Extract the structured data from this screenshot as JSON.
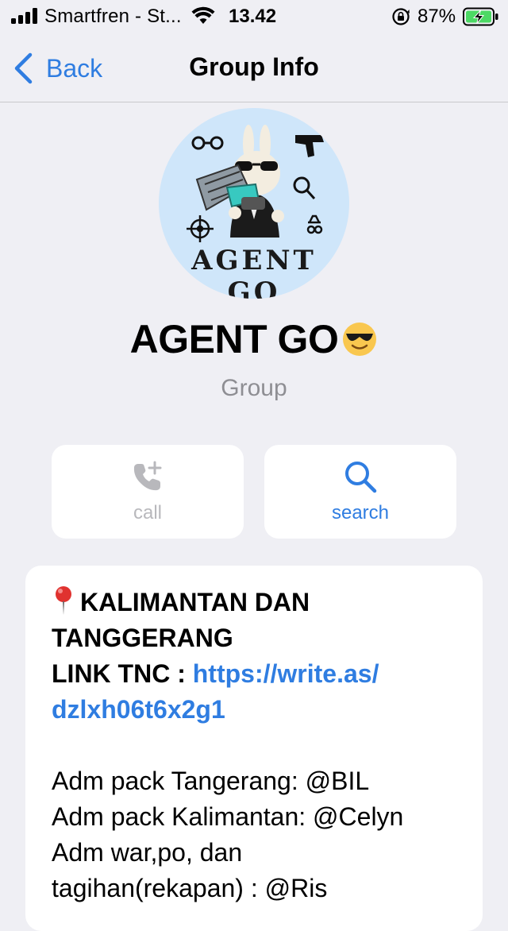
{
  "status_bar": {
    "carrier": "Smartfren - St...",
    "time": "13.42",
    "battery_percent": "87%"
  },
  "nav": {
    "back_label": "Back",
    "title": "Group Info"
  },
  "profile": {
    "avatar_text": "AGENT GO",
    "name": "AGENT GO",
    "name_emoji": "smiling-face-with-sunglasses",
    "subtitle": "Group"
  },
  "actions": {
    "call_label": "call",
    "search_label": "search",
    "call_enabled": false
  },
  "description": {
    "line1": "KALIMANTAN DAN",
    "line2": "TANGGERANG",
    "link_prefix": "LINK TNC : ",
    "link_part1": "https://write.as/",
    "link_part2": "dzlxh06t6x2g1",
    "line_admin1": "Adm pack Tangerang: @BIL",
    "line_admin2": "Adm pack Kalimantan: @Celyn",
    "line_admin3": "Adm war,po, dan",
    "line_admin4": "tagihan(rekapan) : @Ris"
  },
  "colors": {
    "accent": "#2f7de1",
    "background": "#efeff4",
    "secondary_text": "#8e8e93",
    "disabled_icon": "#b8b8bc",
    "battery_charging": "#4cd964"
  }
}
